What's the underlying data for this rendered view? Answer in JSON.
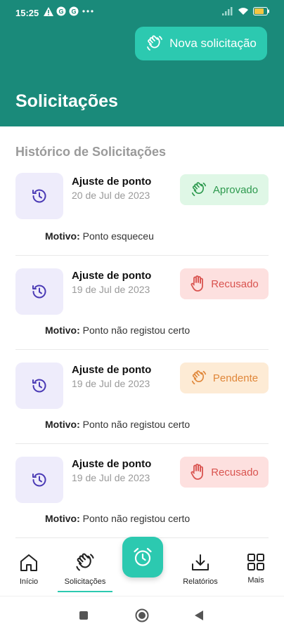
{
  "status_bar": {
    "time": "15:25"
  },
  "header": {
    "new_request_label": "Nova solicitação",
    "title": "Solicitações"
  },
  "history": {
    "section_title": "Histórico de Solicitações",
    "reason_label": "Motivo:",
    "requests": [
      {
        "type": "Ajuste de ponto",
        "date": "20 de Jul de 2023",
        "status": "Aprovado",
        "reason": "Ponto esqueceu"
      },
      {
        "type": "Ajuste de ponto",
        "date": "19 de Jul de 2023",
        "status": "Recusado",
        "reason": "Ponto não registou certo"
      },
      {
        "type": "Ajuste de ponto",
        "date": "19 de Jul de 2023",
        "status": "Pendente",
        "reason": "Ponto não registou certo"
      },
      {
        "type": "Ajuste de ponto",
        "date": "19 de Jul de 2023",
        "status": "Recusado",
        "reason": "Ponto não registou certo"
      }
    ]
  },
  "bottom_nav": {
    "items": [
      {
        "label": "Início",
        "icon": "home-icon"
      },
      {
        "label": "Solicitações",
        "icon": "hand-icon",
        "active": true
      },
      {
        "label": "Relatórios",
        "icon": "download-icon"
      },
      {
        "label": "Mais",
        "icon": "grid-icon"
      }
    ],
    "fab_icon": "alarm-clock-icon"
  },
  "colors": {
    "primary": "#1a8a7a",
    "accent": "#2cc9b0",
    "approved_bg": "#dff7e6",
    "approved_fg": "#2e9a4f",
    "rejected_bg": "#fde0df",
    "rejected_fg": "#d9534f",
    "pending_bg": "#fdebd5",
    "pending_fg": "#e0873a",
    "icon_tile_bg": "#eeecfb",
    "icon_fg": "#4a3ab5"
  }
}
